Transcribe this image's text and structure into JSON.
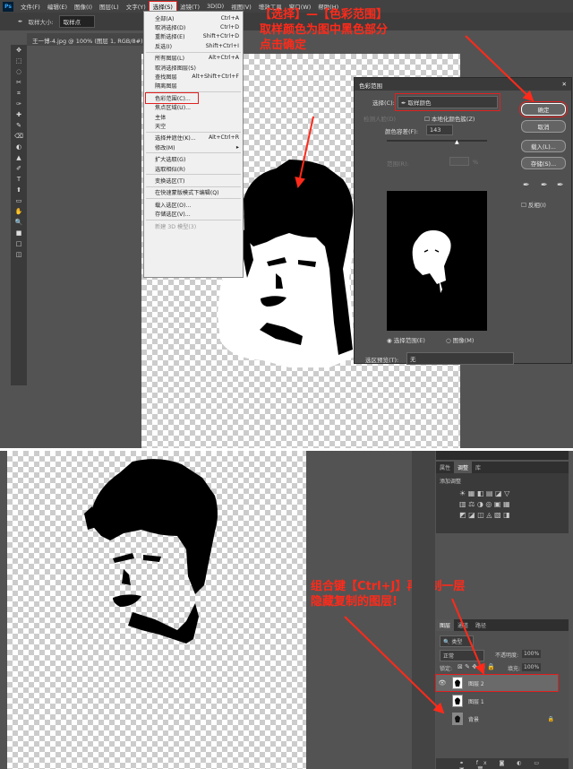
{
  "menubar": {
    "logo": "Ps",
    "items": [
      "文件(F)",
      "编辑(E)",
      "图像(I)",
      "图层(L)",
      "文字(Y)",
      "选择(S)",
      "滤镜(T)",
      "3D(D)",
      "视图(V)",
      "增效工具",
      "窗口(W)",
      "帮助(H)"
    ]
  },
  "options": {
    "sample_size_label": "取样大小:",
    "sample_size_value": "取样点"
  },
  "document_tab": "王一博-4.jpg @ 100% (图层 1, RGB/8#) *",
  "select_menu": [
    {
      "label": "全部(A)",
      "shortcut": "Ctrl+A"
    },
    {
      "label": "取消选择(D)",
      "shortcut": "Ctrl+D"
    },
    {
      "label": "重新选择(E)",
      "shortcut": "Shift+Ctrl+D"
    },
    {
      "label": "反选(I)",
      "shortcut": "Shift+Ctrl+I"
    },
    {
      "sep": true
    },
    {
      "label": "所有图层(L)",
      "shortcut": "Alt+Ctrl+A"
    },
    {
      "label": "取消选择图层(S)",
      "shortcut": ""
    },
    {
      "label": "查找图层",
      "shortcut": "Alt+Shift+Ctrl+F"
    },
    {
      "label": "隔离图层",
      "shortcut": ""
    },
    {
      "sep": true
    },
    {
      "label": "色彩范围(C)...",
      "shortcut": "",
      "highlight": true
    },
    {
      "label": "焦点区域(U)...",
      "shortcut": ""
    },
    {
      "label": "主体",
      "shortcut": ""
    },
    {
      "label": "天空",
      "shortcut": ""
    },
    {
      "sep": true
    },
    {
      "label": "选择并遮住(K)...",
      "shortcut": "Alt+Ctrl+R"
    },
    {
      "label": "修改(M)",
      "shortcut": "▸"
    },
    {
      "sep": true
    },
    {
      "label": "扩大选取(G)",
      "shortcut": ""
    },
    {
      "label": "选取相似(R)",
      "shortcut": ""
    },
    {
      "sep": true
    },
    {
      "label": "变换选区(T)",
      "shortcut": ""
    },
    {
      "sep": true
    },
    {
      "label": "在快速蒙版模式下编辑(Q)",
      "shortcut": ""
    },
    {
      "sep": true
    },
    {
      "label": "载入选区(O)...",
      "shortcut": ""
    },
    {
      "label": "存储选区(V)...",
      "shortcut": ""
    },
    {
      "sep": true
    },
    {
      "label": "新建 3D 模型(3)",
      "shortcut": "",
      "disabled": true
    }
  ],
  "annotation_top": [
    "【选择】—【色彩范围】",
    "取样颜色为图中黑色部分",
    "点击确定"
  ],
  "dialog": {
    "title": "色彩范围",
    "select_label": "选择(C):",
    "select_value": "取样颜色",
    "detect_faces": "检测人脸(D)",
    "localized": "本地化颜色簇(Z)",
    "fuzziness_label": "颜色容差(F):",
    "fuzziness_value": "143",
    "range_label": "范围(R):",
    "range_unit": "%",
    "ok": "确定",
    "cancel": "取消",
    "load": "载入(L)...",
    "save": "存储(S)...",
    "invert": "反相(I)",
    "radio_selection": "选择范围(E)",
    "radio_image": "图像(M)",
    "preview_label": "选区预览(T):",
    "preview_value": "无"
  },
  "annotation_bottom": [
    "组合键【Ctrl+J】再复制一层",
    "隐藏复制的图层!"
  ],
  "adjust_panel": {
    "tabs": [
      "属性",
      "调整",
      "库"
    ],
    "title": "添加调整"
  },
  "layers_panel": {
    "tabs": [
      "图层",
      "通道",
      "路径"
    ],
    "kind": "类型",
    "blend": "正常",
    "opacity_label": "不透明度:",
    "opacity": "100%",
    "lock_label": "锁定:",
    "fill_label": "填充:",
    "fill": "100%",
    "layers": [
      {
        "name": "图层 2"
      },
      {
        "name": "图层 1"
      },
      {
        "name": "背景"
      }
    ]
  },
  "colors": {
    "annotation": "#ff2a1a",
    "ps_bg": "#535353"
  }
}
